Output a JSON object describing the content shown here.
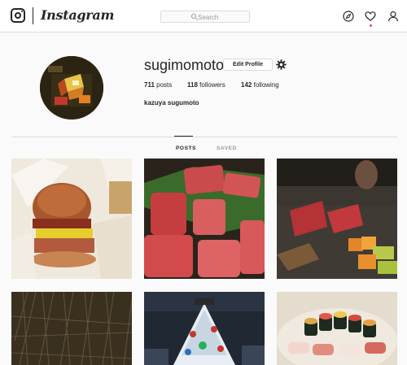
{
  "app": {
    "name": "Instagram"
  },
  "search": {
    "placeholder": "Search"
  },
  "nav": {
    "icons": [
      "explore-icon",
      "heart-icon",
      "profile-icon"
    ]
  },
  "profile": {
    "username": "sugimomoto",
    "edit_label": "Edit Profile",
    "posts_count": "711",
    "posts_label": "posts",
    "followers_count": "118",
    "followers_label": "followers",
    "following_count": "142",
    "following_label": "following",
    "full_name": "kazuya sugumoto"
  },
  "tabs": [
    {
      "label": "POSTS",
      "active": true
    },
    {
      "label": "SAVED",
      "active": false
    }
  ],
  "colors": {
    "notification": "#ed4956",
    "border": "#dbdbdb",
    "text": "#262626",
    "muted": "#999999"
  },
  "grid": {
    "tiles": [
      {
        "subject": "hamburger"
      },
      {
        "subject": "raw beef slices"
      },
      {
        "subject": "meat on grill"
      },
      {
        "subject": "dried grass"
      },
      {
        "subject": "christmas tree"
      },
      {
        "subject": "sushi"
      }
    ]
  }
}
